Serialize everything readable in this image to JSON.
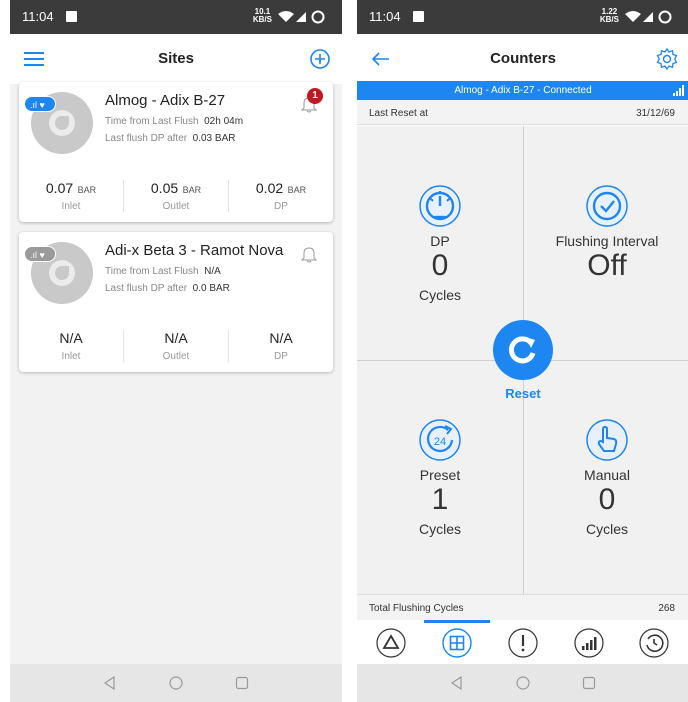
{
  "status": {
    "time": "11:04",
    "speed_left": "10.1\nKB/S",
    "speed_right": "1.22\nKB/S"
  },
  "sites": {
    "title": "Sites",
    "cards": [
      {
        "name": "Almog - Adix B-27",
        "time_label": "Time from Last Flush",
        "time_value": "02h 04m",
        "dp_label": "Last flush DP after",
        "dp_value": "0.03 BAR",
        "alerts": "1",
        "readings": [
          {
            "value": "0.07",
            "unit": "BAR",
            "label": "Inlet"
          },
          {
            "value": "0.05",
            "unit": "BAR",
            "label": "Outlet"
          },
          {
            "value": "0.02",
            "unit": "BAR",
            "label": "DP"
          }
        ]
      },
      {
        "name": "Adi-x Beta 3 - Ramot Nova",
        "time_label": "Time from Last Flush",
        "time_value": "N/A",
        "dp_label": "Last flush DP after",
        "dp_value": "0.0 BAR",
        "readings": [
          {
            "value": "N/A",
            "unit": "",
            "label": "Inlet"
          },
          {
            "value": "N/A",
            "unit": "",
            "label": "Outlet"
          },
          {
            "value": "N/A",
            "unit": "",
            "label": "DP"
          }
        ]
      }
    ]
  },
  "counters": {
    "title": "Counters",
    "connection": "Almog - Adix B-27 - Connected",
    "last_reset_label": "Last Reset at",
    "last_reset_value": "31/12/69",
    "dp": {
      "label": "DP",
      "value": "0",
      "unit": "Cycles"
    },
    "interval": {
      "label": "Flushing Interval",
      "value": "Off"
    },
    "preset": {
      "label": "Preset",
      "value": "1",
      "unit": "Cycles",
      "icon_text": "24"
    },
    "manual": {
      "label": "Manual",
      "value": "0",
      "unit": "Cycles"
    },
    "reset_label": "Reset",
    "total_label": "Total Flushing Cycles",
    "total_value": "268"
  },
  "colors": {
    "accent": "#1d86f0",
    "alert": "#c0191f",
    "statusbar": "#3b3b3b"
  },
  "icons": [
    "menu-icon",
    "add-circle-icon",
    "back-arrow-icon",
    "settings-gear-icon",
    "bell-icon",
    "gauge-icon",
    "clock-icon",
    "refresh-24-icon",
    "hand-pointer-icon",
    "reset-icon",
    "warning-triangle-icon",
    "dashboard-grid-icon",
    "exclamation-icon",
    "signal-chart-icon",
    "history-icon"
  ]
}
